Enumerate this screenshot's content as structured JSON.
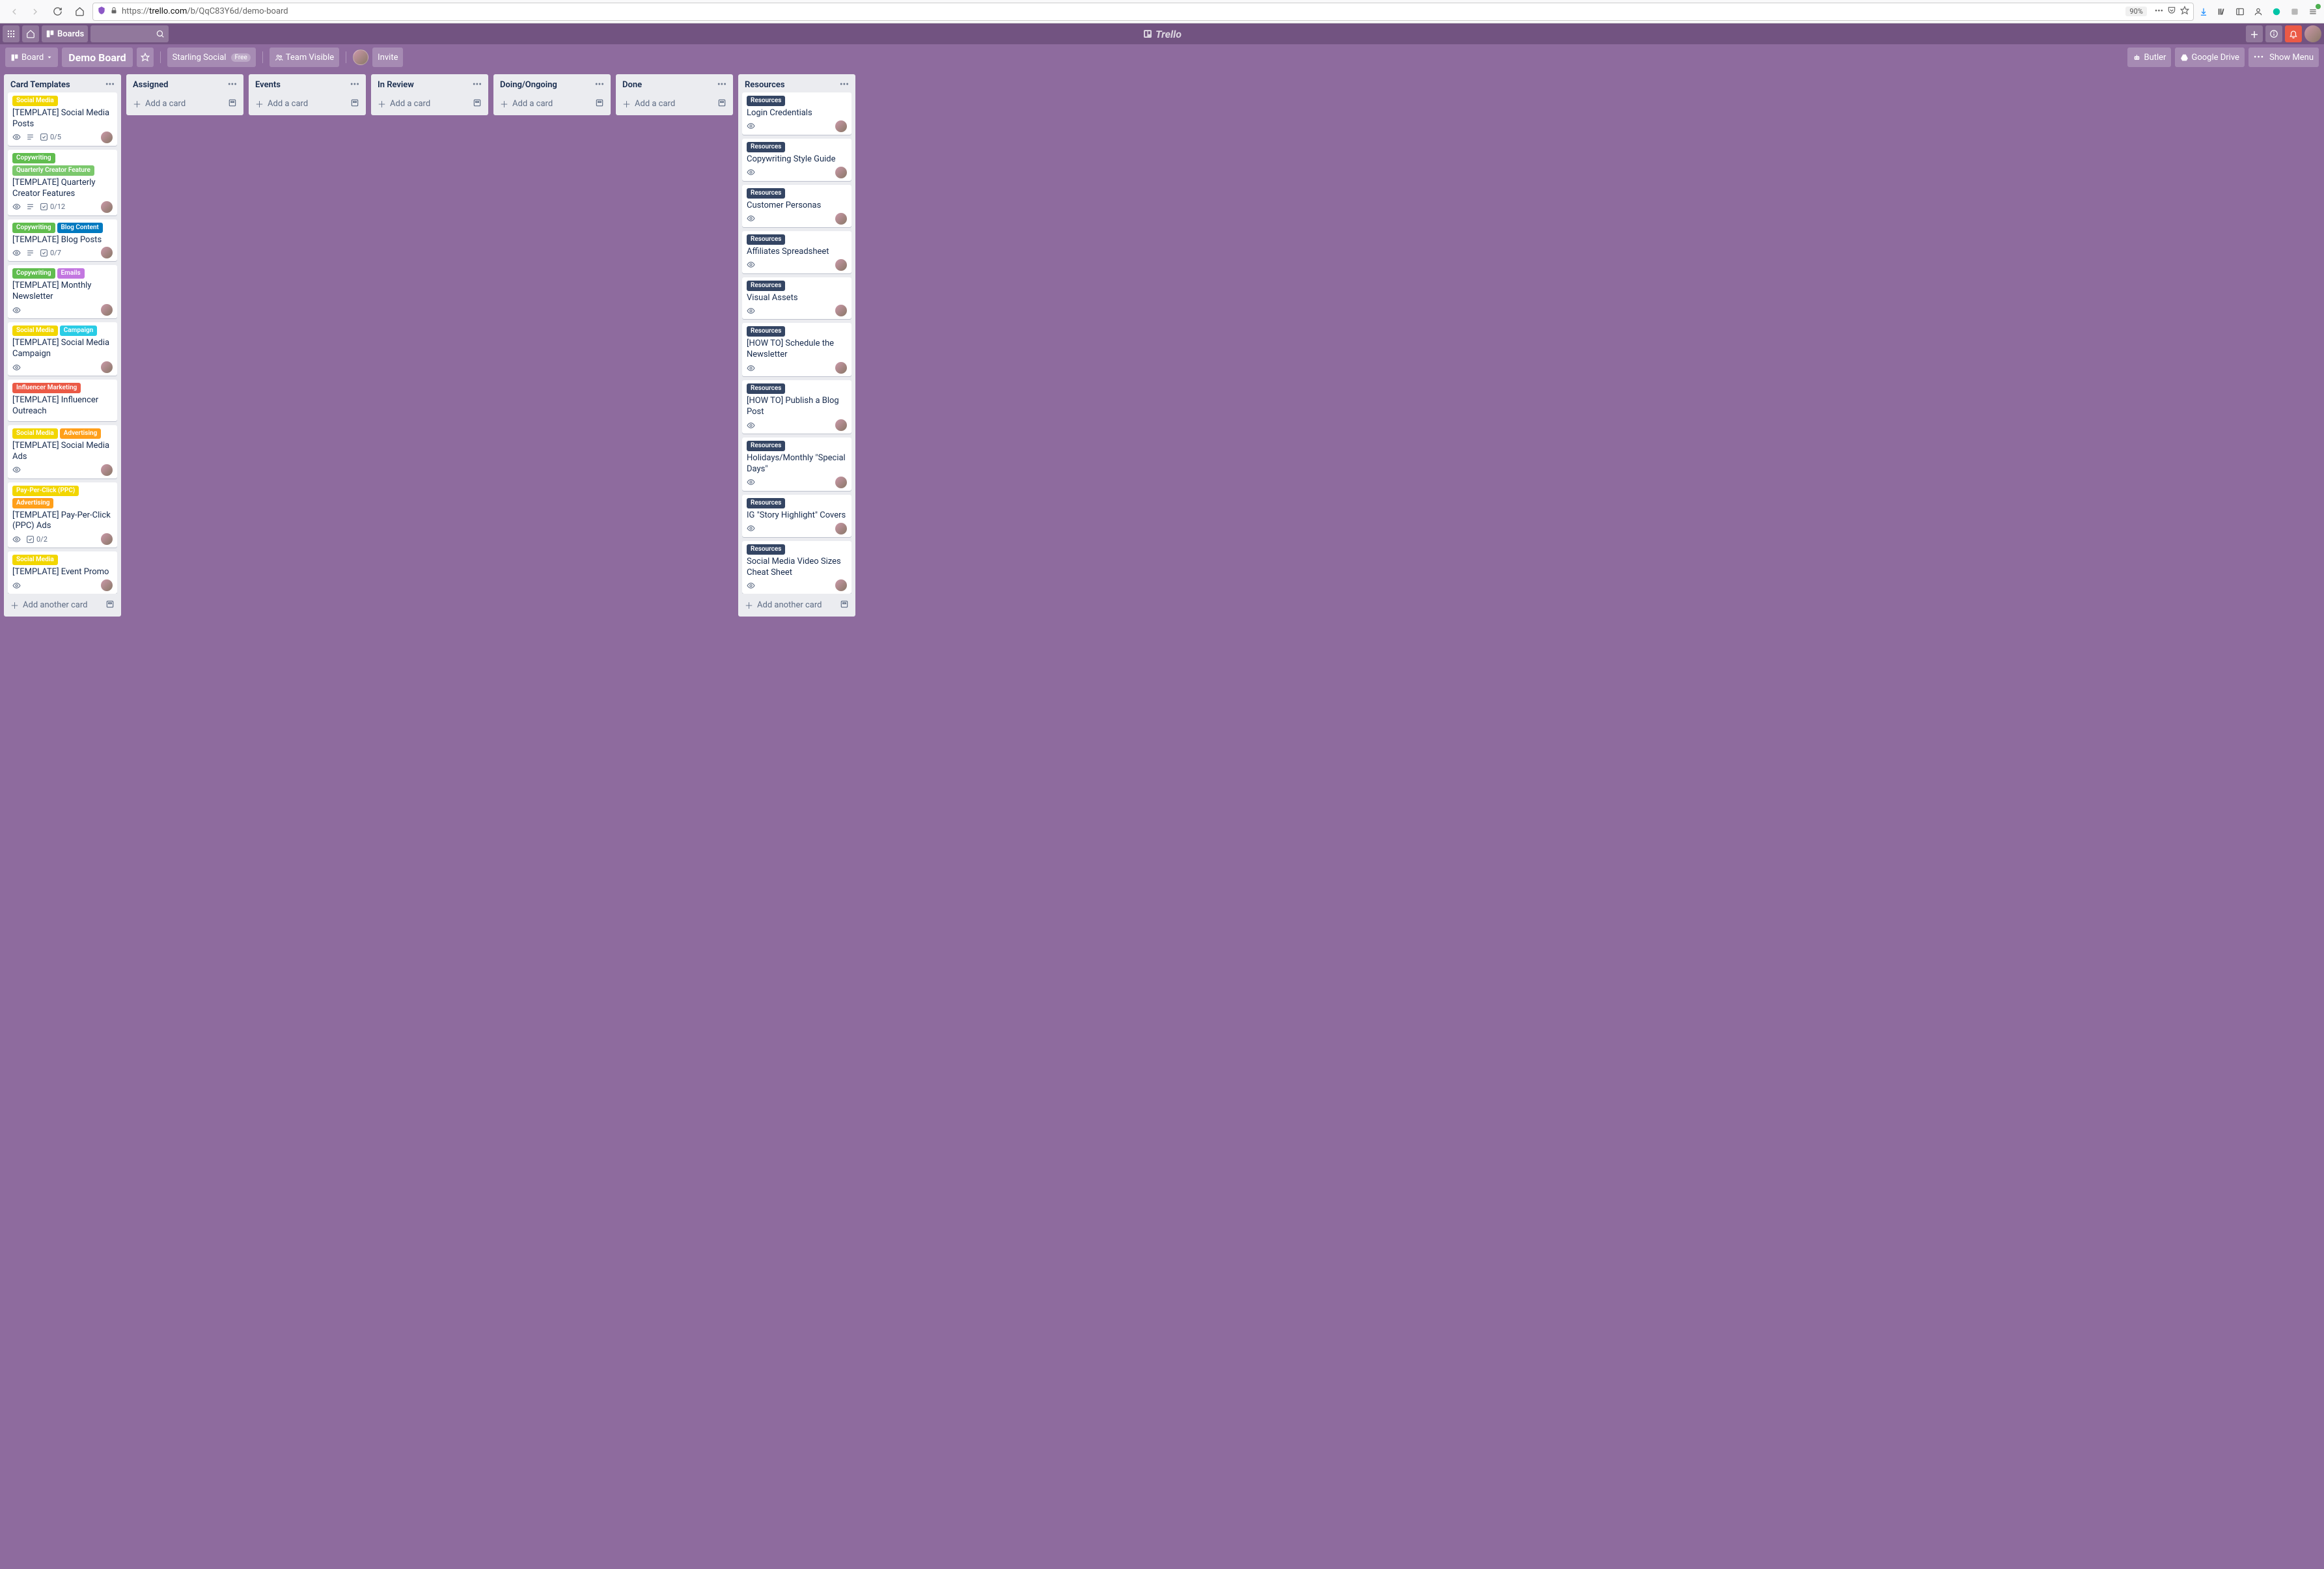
{
  "browser": {
    "url_prefix": "https://",
    "url_host": "trello.com",
    "url_path": "/b/QqC83Y6d/demo-board",
    "zoom": "90%"
  },
  "header": {
    "boards_label": "Boards",
    "logo": "Trello"
  },
  "board": {
    "board_btn": "Board",
    "title": "Demo Board",
    "org": "Starling Social",
    "org_badge": "Free",
    "visibility": "Team Visible",
    "invite": "Invite",
    "butler": "Butler",
    "gdrive": "Google Drive",
    "showmenu": "Show Menu"
  },
  "labels_palette": {
    "social_media": {
      "text": "Social Media",
      "class": "c-yellow"
    },
    "copywriting": {
      "text": "Copywriting",
      "class": "c-green"
    },
    "quarterly": {
      "text": "Quarterly Creator Feature",
      "class": "c-lightgreen"
    },
    "blog": {
      "text": "Blog Content",
      "class": "c-blue"
    },
    "emails": {
      "text": "Emails",
      "class": "c-purple"
    },
    "campaign": {
      "text": "Campaign",
      "class": "c-teal"
    },
    "influencer": {
      "text": "Influencer Marketing",
      "class": "c-red"
    },
    "advertising": {
      "text": "Advertising",
      "class": "c-orange"
    },
    "ppc": {
      "text": "Pay-Per-Click (PPC)",
      "class": "c-yellow"
    },
    "resources": {
      "text": "Resources",
      "class": "c-darkblue"
    }
  },
  "lists": [
    {
      "title": "Card Templates",
      "add_label": "Add another card",
      "cards": [
        {
          "labels": [
            "social_media"
          ],
          "title": "[TEMPLATE] Social Media Posts",
          "watch": true,
          "desc": true,
          "checklist": "0/5",
          "member": true
        },
        {
          "labels": [
            "copywriting",
            "quarterly"
          ],
          "title": "[TEMPLATE] Quarterly Creator Features",
          "watch": true,
          "desc": true,
          "checklist": "0/12",
          "member": true
        },
        {
          "labels": [
            "copywriting",
            "blog"
          ],
          "title": "[TEMPLATE] Blog Posts",
          "watch": true,
          "desc": true,
          "checklist": "0/7",
          "member": true
        },
        {
          "labels": [
            "copywriting",
            "emails"
          ],
          "title": "[TEMPLATE] Monthly Newsletter",
          "watch": true,
          "member": true
        },
        {
          "labels": [
            "social_media",
            "campaign"
          ],
          "title": "[TEMPLATE] Social Media Campaign",
          "watch": true,
          "member": true
        },
        {
          "labels": [
            "influencer"
          ],
          "title": "[TEMPLATE] Influencer Outreach",
          "watch": false
        },
        {
          "labels": [
            "social_media",
            "advertising"
          ],
          "title": "[TEMPLATE] Social Media Ads",
          "watch": true,
          "member": true
        },
        {
          "labels": [
            "ppc",
            "advertising"
          ],
          "title": "[TEMPLATE] Pay-Per-Click (PPC) Ads",
          "watch": true,
          "checklist": "0/2",
          "member": true
        },
        {
          "labels": [
            "social_media"
          ],
          "title": "[TEMPLATE] Event Promo",
          "watch": true,
          "member": true
        }
      ]
    },
    {
      "title": "Assigned",
      "add_label": "Add a card",
      "cards": []
    },
    {
      "title": "Events",
      "add_label": "Add a card",
      "cards": []
    },
    {
      "title": "In Review",
      "add_label": "Add a card",
      "cards": []
    },
    {
      "title": "Doing/Ongoing",
      "add_label": "Add a card",
      "cards": []
    },
    {
      "title": "Done",
      "add_label": "Add a card",
      "cards": []
    },
    {
      "title": "Resources",
      "add_label": "Add another card",
      "cards": [
        {
          "labels": [
            "resources"
          ],
          "title": "Login Credentials",
          "watch": true,
          "member": true
        },
        {
          "labels": [
            "resources"
          ],
          "title": "Copywriting Style Guide",
          "watch": true,
          "member": true
        },
        {
          "labels": [
            "resources"
          ],
          "title": "Customer Personas",
          "watch": true,
          "member": true
        },
        {
          "labels": [
            "resources"
          ],
          "title": "Affiliates Spreadsheet",
          "watch": true,
          "member": true
        },
        {
          "labels": [
            "resources"
          ],
          "title": "Visual Assets",
          "watch": true,
          "member": true
        },
        {
          "labels": [
            "resources"
          ],
          "title": "[HOW TO] Schedule the Newsletter",
          "watch": true,
          "member": true
        },
        {
          "labels": [
            "resources"
          ],
          "title": "[HOW TO] Publish a Blog Post",
          "watch": true,
          "member": true
        },
        {
          "labels": [
            "resources"
          ],
          "title": "Holidays/Monthly \"Special Days\"",
          "watch": true,
          "member": true
        },
        {
          "labels": [
            "resources"
          ],
          "title": "IG \"Story Highlight\" Covers",
          "watch": true,
          "member": true
        },
        {
          "labels": [
            "resources"
          ],
          "title": "Social Media Video Sizes Cheat Sheet",
          "watch": true,
          "member": true
        }
      ]
    }
  ]
}
